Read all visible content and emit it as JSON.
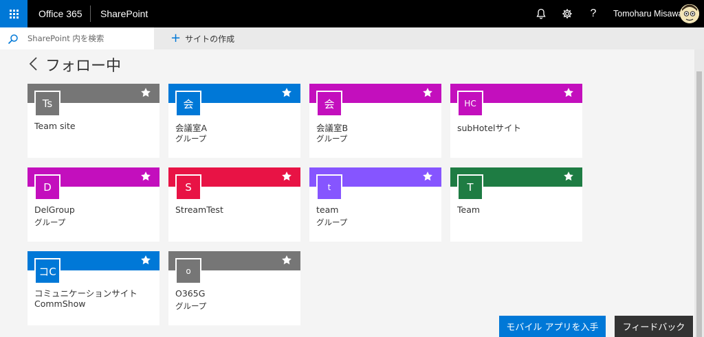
{
  "suite": {
    "brand": "Office 365",
    "app": "SharePoint",
    "user": "Tomoharu Misawa",
    "icons": [
      "waffle-icon",
      "bell-icon",
      "gear-icon",
      "help-icon"
    ]
  },
  "search": {
    "placeholder": "SharePoint 内を検索"
  },
  "command": {
    "create_site": "サイトの作成"
  },
  "page": {
    "title": "フォロー中"
  },
  "tiles": [
    {
      "initials": "Ts",
      "name": "Team site",
      "sub": "",
      "color": "#767676"
    },
    {
      "initials": "会",
      "name": "会議室A",
      "sub": "グループ",
      "color": "#0078d7"
    },
    {
      "initials": "会",
      "name": "会議室B",
      "sub": "グループ",
      "color": "#c30fbd"
    },
    {
      "initials": "HC",
      "name": "subHotelサイト",
      "sub": "",
      "color": "#c30fbd"
    },
    {
      "initials": "D",
      "name": "DelGroup",
      "sub": "グループ",
      "color": "#c30fbd"
    },
    {
      "initials": "S",
      "name": "StreamTest",
      "sub": "",
      "color": "#e81345"
    },
    {
      "initials": "t",
      "name": "team",
      "sub": "グループ",
      "color": "#8655ff"
    },
    {
      "initials": "T",
      "name": "Team",
      "sub": "",
      "color": "#1e7c43"
    },
    {
      "initials": "コC",
      "name": "コミュニケーションサイト",
      "name2": "CommShow",
      "sub": "",
      "color": "#0078d7"
    },
    {
      "initials": "o",
      "name": "O365G",
      "sub": "グループ",
      "color": "#767676"
    }
  ],
  "buttons": {
    "mobile": "モバイル アプリを入手",
    "feedback": "フィードバック"
  },
  "colors": {
    "accent": "#0078d7",
    "suite_bg": "#000000",
    "feedback_bg": "#333333"
  }
}
